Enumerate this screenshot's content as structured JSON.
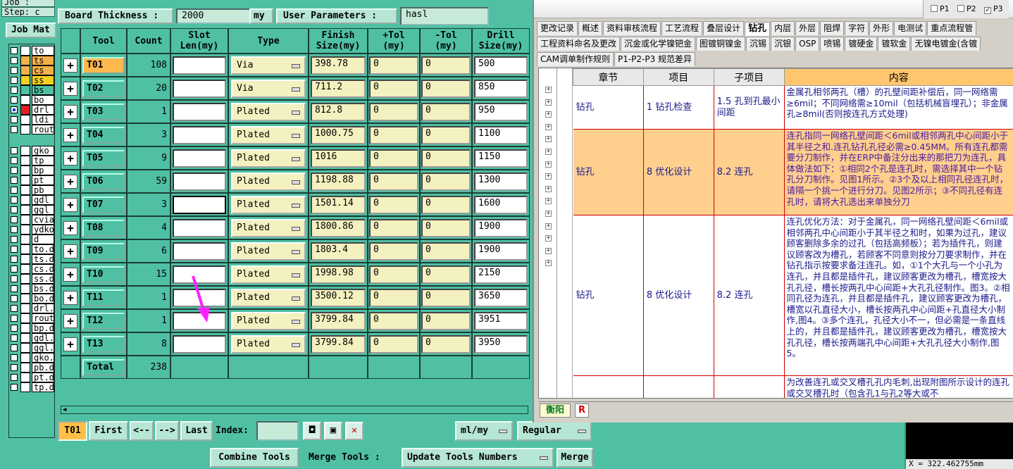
{
  "left": {
    "job_lines": [
      "Job : ",
      "Step: c"
    ],
    "job_button": "Job Mat",
    "layers": [
      {
        "name": "to",
        "color": "#ffffff"
      },
      {
        "name": "ts",
        "color": "#f5b04a"
      },
      {
        "name": "cs",
        "color": "#f5b04a"
      },
      {
        "name": "ss",
        "color": "#f5d020"
      },
      {
        "name": "bs",
        "color": "#4fc0a4"
      },
      {
        "name": "bo",
        "color": "#ffffff"
      },
      {
        "name": "drl",
        "color": "#e02020",
        "active": true
      },
      {
        "name": "ldi",
        "color": "#ffffff"
      },
      {
        "name": "rout",
        "color": "#ffffff"
      },
      {
        "name": "gko",
        "color": "#ffffff"
      },
      {
        "name": "tp",
        "color": "#ffffff"
      },
      {
        "name": "bp",
        "color": "#ffffff"
      },
      {
        "name": "pt",
        "color": "#ffffff"
      },
      {
        "name": "pb",
        "color": "#ffffff"
      },
      {
        "name": "gdl",
        "color": "#ffffff"
      },
      {
        "name": "ggl",
        "color": "#ffffff"
      },
      {
        "name": "cvia",
        "color": "#ffffff"
      },
      {
        "name": "ydko",
        "color": "#ffffff"
      },
      {
        "name": "d",
        "color": "#ffffff"
      },
      {
        "name": "to.d",
        "color": "#ffffff"
      },
      {
        "name": "ts.d",
        "color": "#ffffff"
      },
      {
        "name": "cs.d",
        "color": "#ffffff"
      },
      {
        "name": "ss.d",
        "color": "#ffffff"
      },
      {
        "name": "bs.d",
        "color": "#ffffff"
      },
      {
        "name": "bo.d",
        "color": "#ffffff"
      },
      {
        "name": "drl.",
        "color": "#ffffff"
      },
      {
        "name": "rout",
        "color": "#ffffff"
      },
      {
        "name": "bp.d",
        "color": "#ffffff"
      },
      {
        "name": "gdl.",
        "color": "#ffffff"
      },
      {
        "name": "ggl.",
        "color": "#ffffff"
      },
      {
        "name": "gko.",
        "color": "#ffffff"
      },
      {
        "name": "pb.d",
        "color": "#ffffff"
      },
      {
        "name": "pt.d",
        "color": "#ffffff"
      },
      {
        "name": "tp.d",
        "color": "#ffffff"
      }
    ]
  },
  "header": {
    "board_thickness_label": "Board Thickness :",
    "board_thickness_value": "2000",
    "unit": "my",
    "user_params_label": "User Parameters :",
    "user_params_value": "hasl"
  },
  "table": {
    "columns": [
      "Tool",
      "Count",
      "Slot Len(my)",
      "Type",
      "Finish Size(my)",
      "+Tol (my)",
      "-Tol (my)",
      "Drill Size(my)"
    ],
    "rows": [
      {
        "tool": "T01",
        "count": "108",
        "type": "Via",
        "finish": "398.78",
        "ptol": "0",
        "ntol": "0",
        "drill": "500",
        "selected": true
      },
      {
        "tool": "T02",
        "count": "20",
        "type": "Via",
        "finish": "711.2",
        "ptol": "0",
        "ntol": "0",
        "drill": "850"
      },
      {
        "tool": "T03",
        "count": "1",
        "type": "Plated",
        "finish": "812.8",
        "ptol": "0",
        "ntol": "0",
        "drill": "950"
      },
      {
        "tool": "T04",
        "count": "3",
        "type": "Plated",
        "finish": "1000.75",
        "ptol": "0",
        "ntol": "0",
        "drill": "1100"
      },
      {
        "tool": "T05",
        "count": "9",
        "type": "Plated",
        "finish": "1016",
        "ptol": "0",
        "ntol": "0",
        "drill": "1150"
      },
      {
        "tool": "T06",
        "count": "59",
        "type": "Plated",
        "finish": "1198.88",
        "ptol": "0",
        "ntol": "0",
        "drill": "1300"
      },
      {
        "tool": "T07",
        "count": "3",
        "type": "Plated",
        "finish": "1501.14",
        "ptol": "0",
        "ntol": "0",
        "drill": "1600",
        "slot_black": true
      },
      {
        "tool": "T08",
        "count": "4",
        "type": "Plated",
        "finish": "1800.86",
        "ptol": "0",
        "ntol": "0",
        "drill": "1900"
      },
      {
        "tool": "T09",
        "count": "6",
        "type": "Plated",
        "finish": "1803.4",
        "ptol": "0",
        "ntol": "0",
        "drill": "1900"
      },
      {
        "tool": "T10",
        "count": "15",
        "type": "Plated",
        "finish": "1998.98",
        "ptol": "0",
        "ntol": "0",
        "drill": "2150"
      },
      {
        "tool": "T11",
        "count": "1",
        "type": "Plated",
        "finish": "3500.12",
        "ptol": "0",
        "ntol": "0",
        "drill": "3650"
      },
      {
        "tool": "T12",
        "count": "1",
        "type": "Plated",
        "finish": "3799.84",
        "ptol": "0",
        "ntol": "0",
        "drill": "3951"
      },
      {
        "tool": "T13",
        "count": "8",
        "type": "Plated",
        "finish": "3799.84",
        "ptol": "0",
        "ntol": "0",
        "drill": "3950"
      }
    ],
    "total_label": "Total",
    "total_count": "238"
  },
  "nav": {
    "current_tool": "T01",
    "first": "First",
    "prev": "<--",
    "next": "-->",
    "last": "Last",
    "index_label": "Index:",
    "units_option": "ml/my",
    "mode_option": "Regular"
  },
  "bottom": {
    "combine": "Combine Tools",
    "merge_label": "Merge Tools :",
    "update": "Update Tools Numbers",
    "merge": "Merge"
  },
  "ref_window": {
    "p_checks": [
      {
        "label": "P1",
        "checked": false
      },
      {
        "label": "P2",
        "checked": false
      },
      {
        "label": "P3",
        "checked": true
      }
    ],
    "tabs_row1": [
      "更改记录",
      "概述",
      "资料审核流程",
      "工艺流程",
      "叠层设计",
      "钻孔",
      "内层",
      "外层",
      "阻焊",
      "字符",
      "外形",
      "电测试",
      "重点流程管"
    ],
    "active_tab": "钻孔",
    "tabs_row2": [
      "工程资料命名及更改",
      "沉金或化学镍钯金",
      "图镀铜镍金",
      "沉锡",
      "沉银",
      "OSP",
      "喷锡",
      "镀硬金",
      "镀软金",
      "无镍电镀金(含镀"
    ],
    "tabs_row3": [
      "CAM调单制作规则",
      "P1-P2-P3 规范差异"
    ],
    "columns": [
      "章节",
      "项目",
      "子项目",
      "内容"
    ],
    "rows": [
      {
        "chapter": "钻孔",
        "item": "1 钻孔检查",
        "sub": "1.5 孔到孔最小间距",
        "content": "金属孔相邻两孔（槽）的孔壁间距补偿后，同一网络需≥6mil；不同网络需≥10mil（包括机械盲埋孔）；非金属孔≥8mil(否则按连孔方式处理)",
        "highlight": false
      },
      {
        "chapter": "钻孔",
        "item": "8 优化设计",
        "sub": "8.2 连孔",
        "content": "连孔指同一网络孔壁间距＜6mil或相邻两孔中心间距小于其半径之和.连孔钻孔孔径必需≥0.45MM。所有连孔都需要分刀制作，并在ERP中备注分出来的那把刀为连孔，具体做法如下：①相同2个孔是连孔时，需选择其中一个钻孔分刀制作。见图1所示。②3个及以上相同孔径连孔时，请隔一个挑一个进行分刀。见图2所示；③不同孔径有连孔时，请将大孔选出来单独分刀",
        "highlight": true
      },
      {
        "chapter": "钻孔",
        "item": "8 优化设计",
        "sub": "8.2 连孔",
        "content": "连孔优化方法：对于金属孔，同一网络孔壁间距＜6mil或相邻两孔中心间距小于其半径之和时，如果为过孔，建议顾客删除多余的过孔（包括高频板）；若为插件孔，则建议顾客改为槽孔，若顾客不同意则按分刀要求制作，并在钻孔指示按要求备注连孔。如，①1个大孔与一个小孔为连孔，并且都是插件孔，建议顾客更改为槽孔，槽宽按大孔孔径，槽长按两孔中心间距+大孔孔径制作。图3。②相同孔径为连孔，并且都是插件孔，建议顾客更改为槽孔，槽宽以孔直径大小，槽长按两孔中心间距+孔直径大小制作,图4。③多个连孔，孔径大小不一，但必需是一条直线上的，并且都是插件孔，建议顾客更改为槽孔，槽宽按大孔孔径，槽长按两端孔中心间距+大孔孔径大小制作,图5。",
        "highlight": false
      },
      {
        "chapter": "",
        "item": "",
        "sub": "",
        "content": "为改善连孔或交叉槽孔孔内毛刺,出现附图所示设计的连孔或交叉槽孔时（包含孔1与孔2等大或不",
        "highlight": false
      }
    ],
    "footer_logo": "衡阳",
    "footer_r": "R"
  },
  "desktop": {
    "coord_text": "X = 322.462755mm"
  }
}
